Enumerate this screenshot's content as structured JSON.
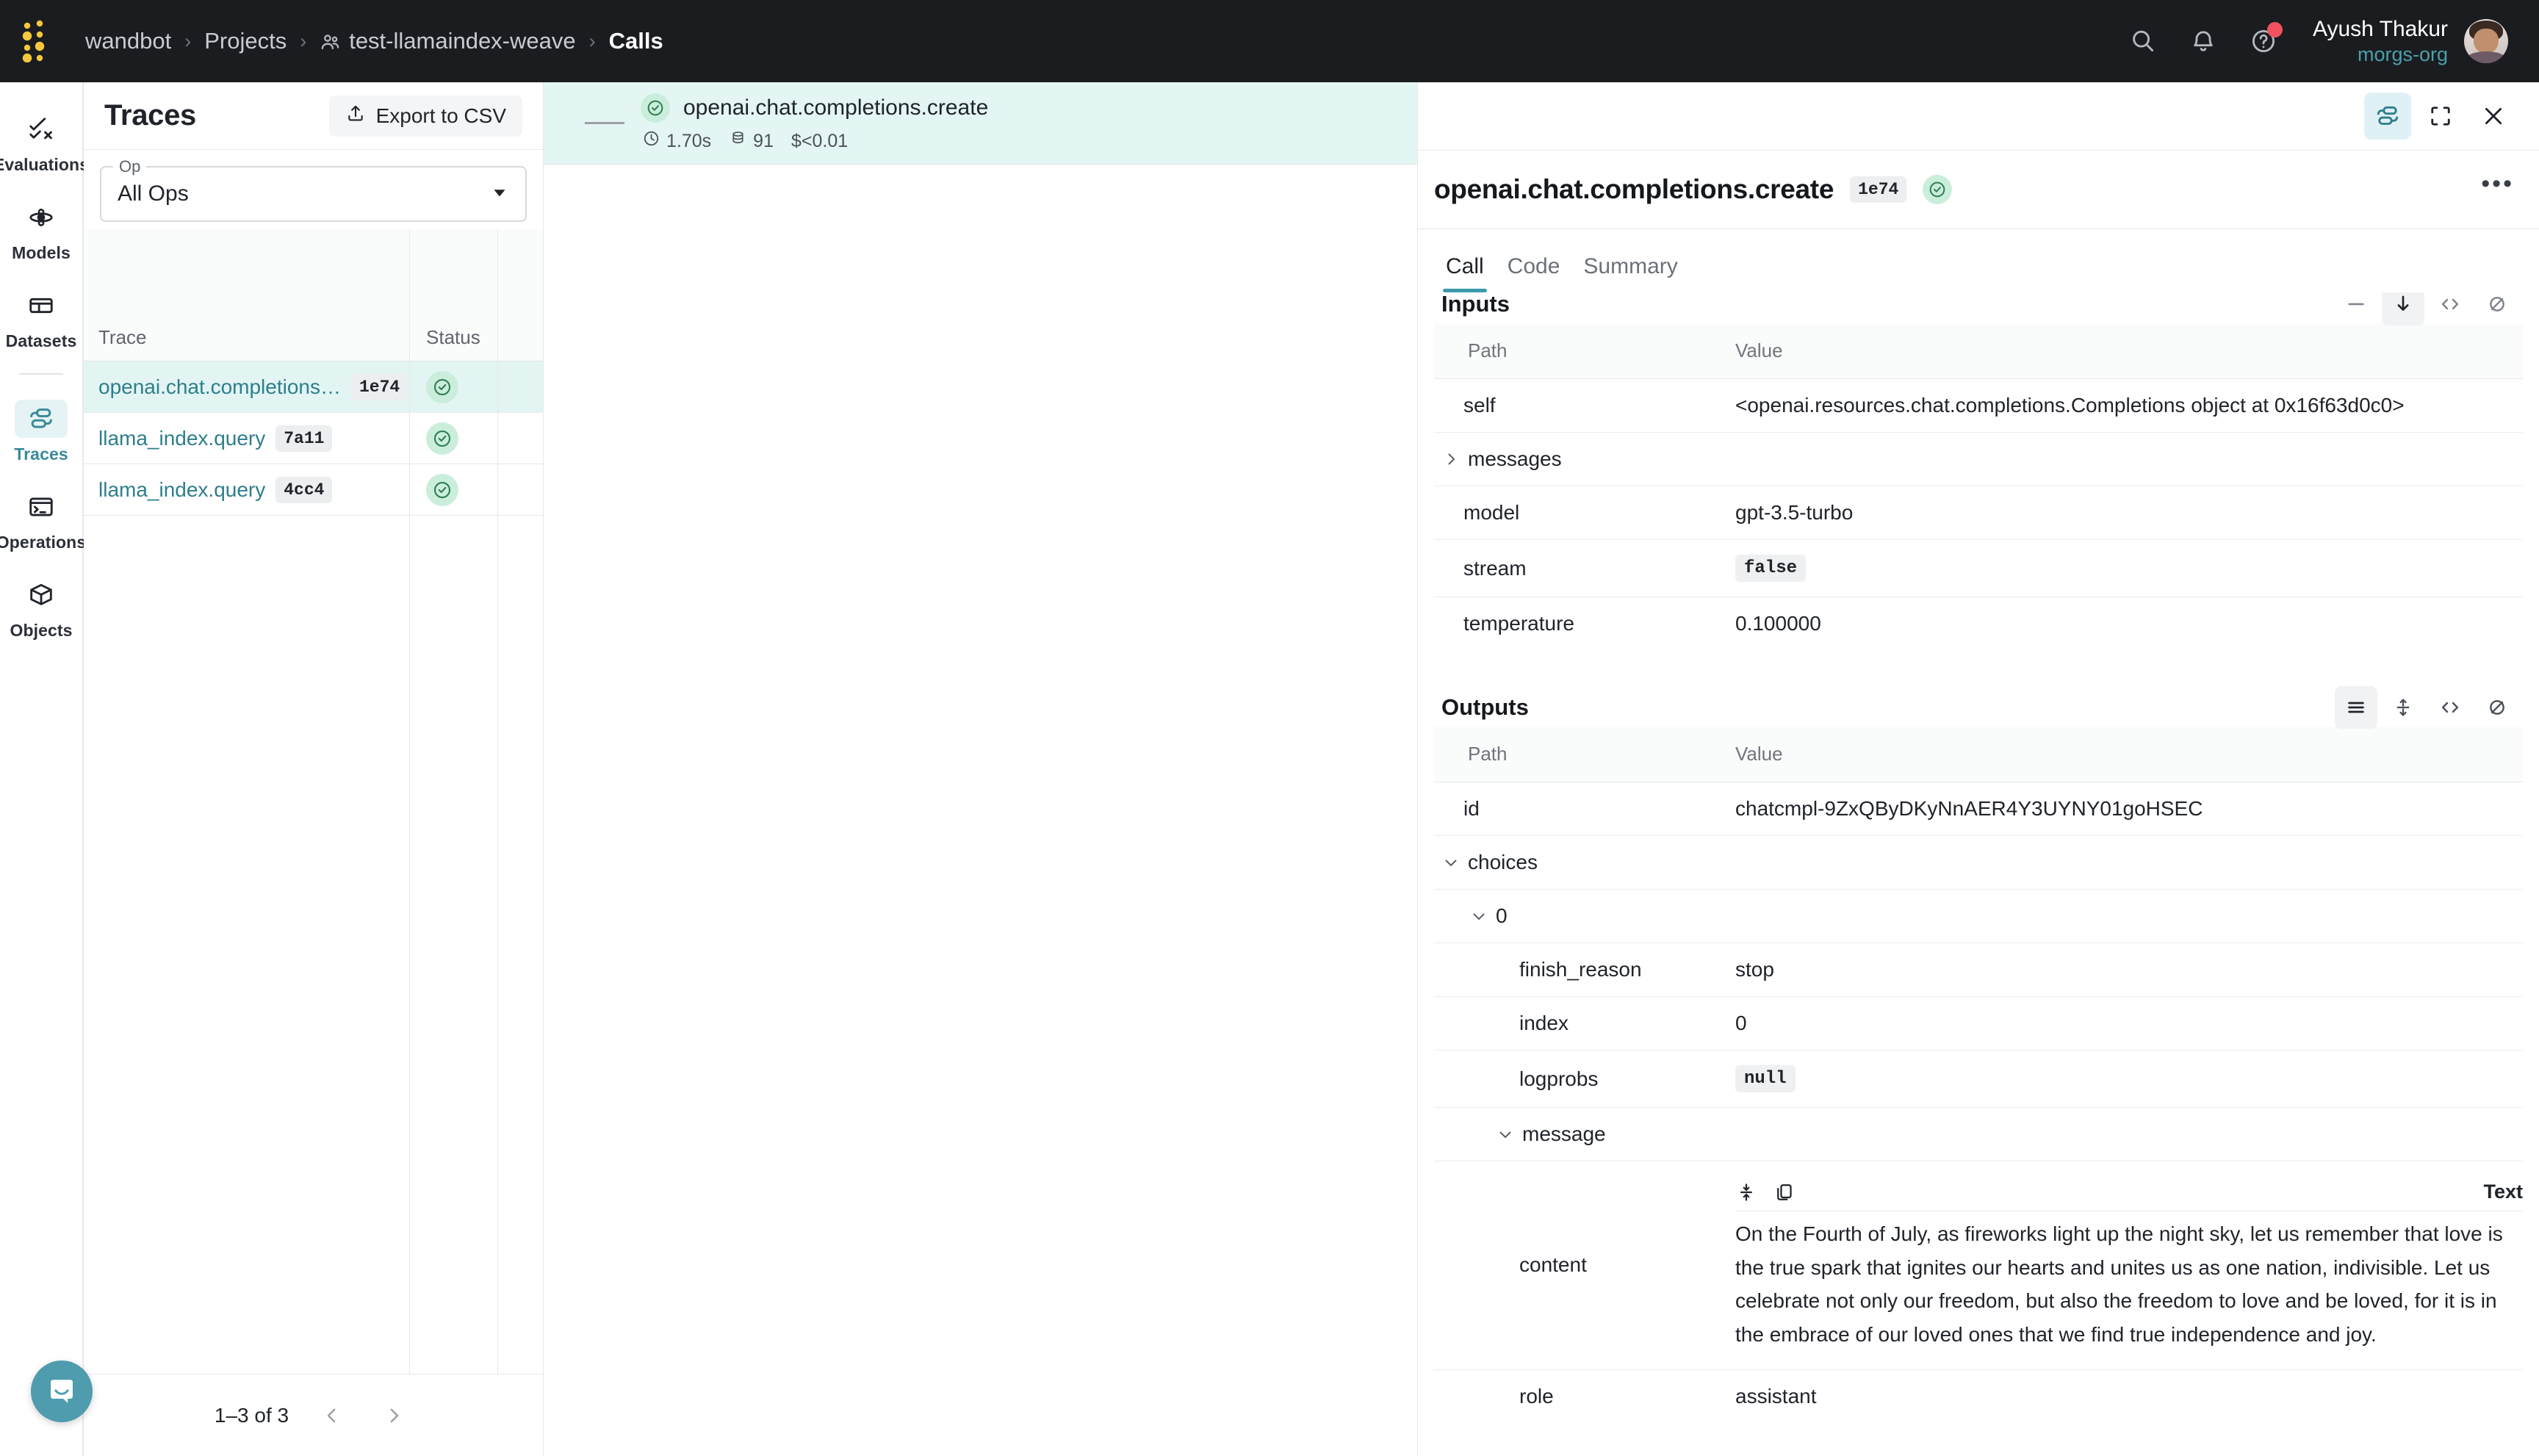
{
  "topbar": {
    "logo_name": "weights-and-biases-logo",
    "breadcrumbs": [
      {
        "label": "wandbot",
        "icon": null,
        "current": false
      },
      {
        "label": "Projects",
        "icon": null,
        "current": false
      },
      {
        "label": "test-llamaindex-weave",
        "icon": "team-icon",
        "current": false
      },
      {
        "label": "Calls",
        "icon": null,
        "current": true
      }
    ],
    "separator": "›",
    "icons": [
      {
        "name": "search-icon"
      },
      {
        "name": "notifications-bell-icon"
      },
      {
        "name": "help-circle-icon",
        "badge": true
      }
    ],
    "user_name": "Ayush Thakur",
    "user_org": "morgs-org",
    "org_color": "#4aa0ad"
  },
  "rail": {
    "items": [
      {
        "label": "Evaluations",
        "icon": "evaluations-icon",
        "active": false
      },
      {
        "label": "Models",
        "icon": "models-icon",
        "active": false
      },
      {
        "label": "Datasets",
        "icon": "datasets-icon",
        "active": false
      },
      {
        "label": "Traces",
        "icon": "traces-icon",
        "active": true
      },
      {
        "label": "Operations",
        "icon": "operations-terminal-icon",
        "active": false
      },
      {
        "label": "Objects",
        "icon": "objects-cube-icon",
        "active": false
      }
    ]
  },
  "traces_panel": {
    "title": "Traces",
    "export_label": "Export to CSV",
    "op_legend": "Op",
    "op_value": "All Ops",
    "columns": [
      "Trace",
      "Status"
    ],
    "rows": [
      {
        "trace": "openai.chat.completions.cre…",
        "id": "1e74",
        "status": "success",
        "selected": true
      },
      {
        "trace": "llama_index.query",
        "id": "7a11",
        "status": "success",
        "selected": false
      },
      {
        "trace": "llama_index.query",
        "id": "4cc4",
        "status": "success",
        "selected": false
      }
    ],
    "pagination_label": "1–3 of 3"
  },
  "tree": {
    "root": {
      "name": "openai.chat.completions.create",
      "status": "success",
      "duration": "1.70s",
      "tokens": "91",
      "cost": "$<0.01"
    }
  },
  "detail": {
    "toolbar": [
      {
        "name": "traces-view-icon",
        "active": true
      },
      {
        "name": "fullscreen-icon",
        "active": false
      },
      {
        "name": "close-icon",
        "active": false
      }
    ],
    "title": "openai.chat.completions.create",
    "id_badge": "1e74",
    "status": "success",
    "more_label": "•••",
    "tabs": [
      {
        "label": "Call",
        "active": true
      },
      {
        "label": "Code",
        "active": false
      },
      {
        "label": "Summary",
        "active": false
      }
    ],
    "inputs": {
      "title": "Inputs",
      "columns": {
        "path": "Path",
        "value": "Value"
      },
      "tools": [
        {
          "name": "collapse-rows-icon",
          "active": false
        },
        {
          "name": "download-icon",
          "active": true
        },
        {
          "name": "code-view-icon",
          "active": false
        },
        {
          "name": "hide-icon",
          "active": false
        }
      ],
      "rows": [
        {
          "path": "self",
          "value": "<openai.resources.chat.completions.Completions object at 0x16f63d0c0>",
          "indent": 0,
          "caret": null,
          "chip": false
        },
        {
          "path": "messages",
          "value": "",
          "indent": 0,
          "caret": "right",
          "chip": false
        },
        {
          "path": "model",
          "value": "gpt-3.5-turbo",
          "indent": 0,
          "caret": null,
          "chip": false
        },
        {
          "path": "stream",
          "value": "false",
          "indent": 0,
          "caret": null,
          "chip": true
        },
        {
          "path": "temperature",
          "value": "0.100000",
          "indent": 0,
          "caret": null,
          "chip": false
        }
      ]
    },
    "outputs": {
      "title": "Outputs",
      "columns": {
        "path": "Path",
        "value": "Value"
      },
      "tools": [
        {
          "name": "list-view-icon",
          "active": true
        },
        {
          "name": "expand-collapse-icon",
          "active": false
        },
        {
          "name": "code-view-icon",
          "active": false
        },
        {
          "name": "hide-icon",
          "active": false
        }
      ],
      "rows": [
        {
          "path": "id",
          "value": "chatcmpl-9ZxQByDKyNnAER4Y3UYNY01goHSEC",
          "indent": 0,
          "caret": null,
          "chip": false
        },
        {
          "path": "choices",
          "value": "",
          "indent": 0,
          "caret": "down",
          "chip": false
        },
        {
          "path": "0",
          "value": "",
          "indent": 1,
          "caret": "down",
          "chip": false
        },
        {
          "path": "finish_reason",
          "value": "stop",
          "indent": 2,
          "caret": null,
          "chip": false
        },
        {
          "path": "index",
          "value": "0",
          "indent": 2,
          "caret": null,
          "chip": false
        },
        {
          "path": "logprobs",
          "value": "null",
          "indent": 2,
          "caret": null,
          "chip": true
        },
        {
          "path": "message",
          "value": "",
          "indent": 1,
          "caret": "down",
          "chip": false
        }
      ],
      "content_row": {
        "path": "content",
        "type_label": "Text",
        "tools": [
          {
            "name": "collapse-vertical-icon"
          },
          {
            "name": "copy-icon"
          }
        ],
        "text": "On the Fourth of July, as fireworks light up the night sky, let us remember that love is the true spark that ignites our hearts and unites us as one nation, indivisible. Let us celebrate not only our freedom, but also the freedom to love and be loved, for it is in the embrace of our loved ones that we find true independence and joy."
      },
      "role_row": {
        "path": "role",
        "value": "assistant"
      }
    }
  },
  "intercom": {
    "name": "intercom-chat-launcher"
  },
  "colors": {
    "header_bg": "#1a1c1f",
    "accent_teal": "#3b99ab",
    "link_teal": "#2e7e8c",
    "selected_row": "#e2f5f3",
    "status_green_bg": "#caeedb",
    "status_green": "#2f7d52",
    "badge_red": "#f0525f",
    "intercom_teal": "#4e9cae"
  }
}
